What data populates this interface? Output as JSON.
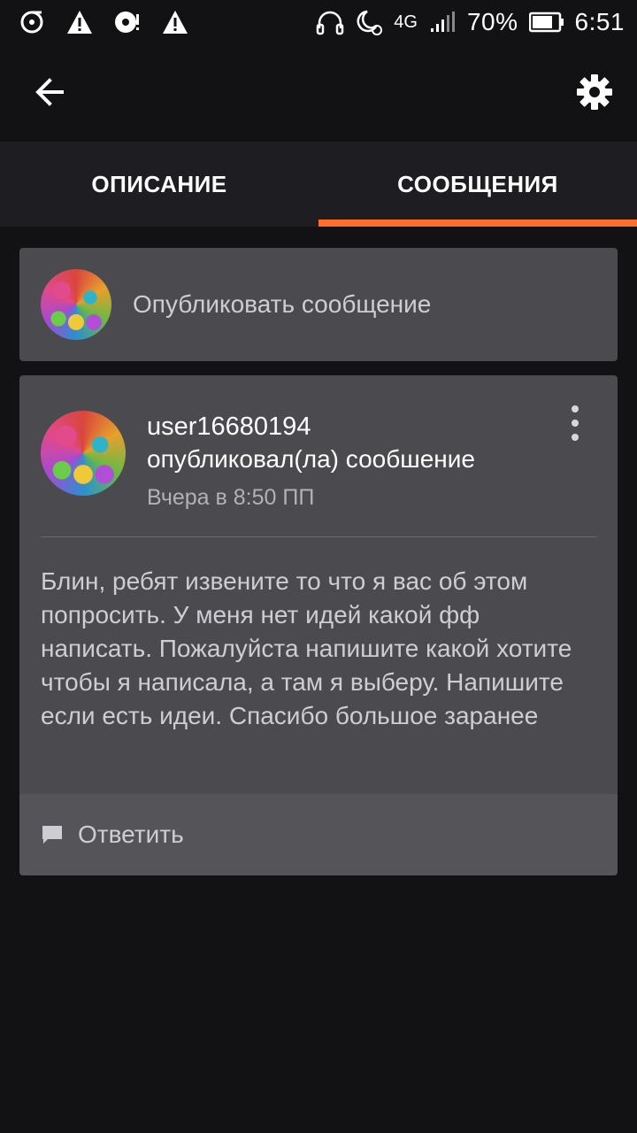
{
  "status_bar": {
    "battery_percent": "70%",
    "time": "6:51",
    "network": "4G",
    "icons": [
      "music-icon",
      "warning-icon",
      "record-icon",
      "warning-icon",
      "headphones-icon",
      "moon-alarm-icon",
      "signal-icon",
      "battery-icon"
    ]
  },
  "app_bar": {
    "back_icon": "arrow-left-icon",
    "settings_icon": "gear-icon"
  },
  "tabs": [
    {
      "label": "ОПИСАНИЕ",
      "active": false
    },
    {
      "label": "СООБЩЕНИЯ",
      "active": true
    }
  ],
  "compose": {
    "placeholder": "Опубликовать сообщение"
  },
  "post": {
    "username": "user16680194",
    "action": "опубликовал(ла) сообшение",
    "time": "Вчера в 8:50 ПП",
    "body": "Блин, ребят извените то что я вас об этом попросить. У меня нет идей какой фф написать. Пожалуйста напишите какой хотите чтобы я написала, а там я выберу. Напишите если есть идеи. Спасибо большое заранее",
    "reply_label": "Ответить"
  },
  "colors": {
    "accent": "#ff6e2a",
    "background": "#121114",
    "card": "#4b4a4f"
  }
}
